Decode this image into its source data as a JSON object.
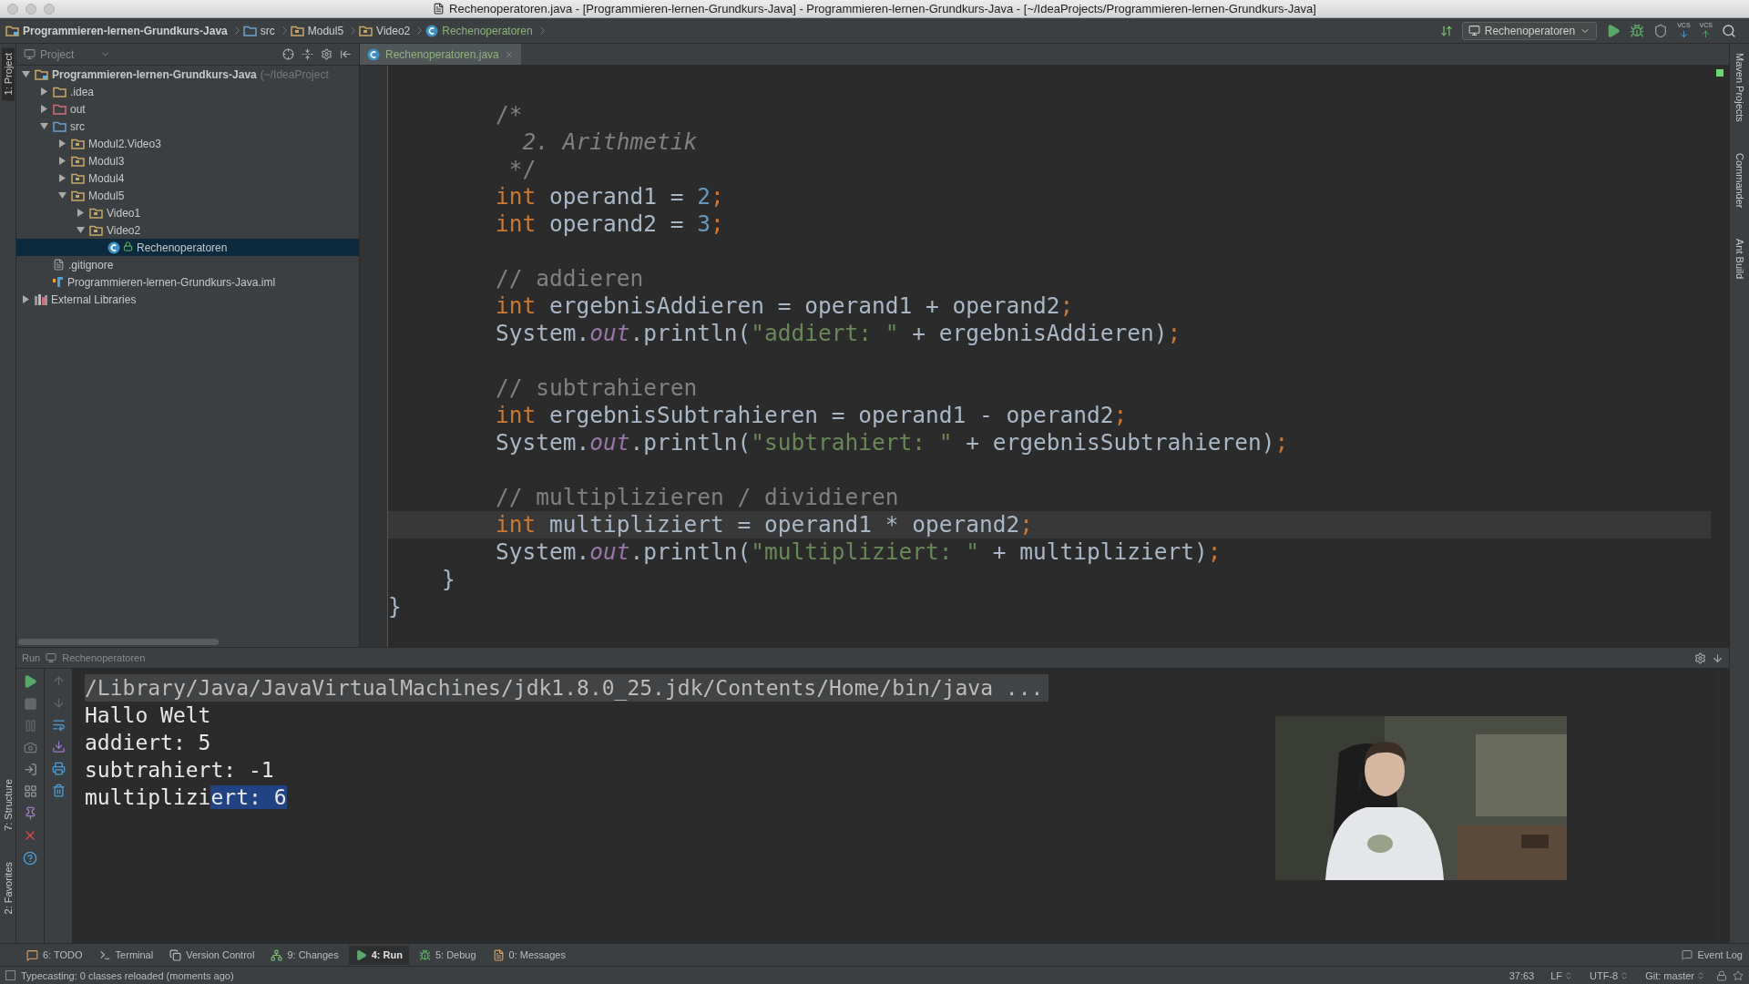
{
  "window": {
    "title": "Rechenoperatoren.java - [Programmieren-lernen-Grundkurs-Java] - Programmieren-lernen-Grundkurs-Java - [~/IdeaProjects/Programmieren-lernen-Grundkurs-Java]"
  },
  "breadcrumbs": [
    {
      "label": "Programmieren-lernen-Grundkurs-Java",
      "kind": "project"
    },
    {
      "label": "src",
      "kind": "source"
    },
    {
      "label": "Modul5",
      "kind": "package"
    },
    {
      "label": "Video2",
      "kind": "package"
    },
    {
      "label": "Rechenoperatoren",
      "kind": "class"
    }
  ],
  "toolbar": {
    "run_config": "Rechenoperatoren",
    "vcs_buttons": [
      {
        "label": "VCS",
        "kind": "update"
      },
      {
        "label": "VCS",
        "kind": "commit"
      }
    ]
  },
  "left_strip": [
    {
      "label": "1: Project",
      "selected": true
    },
    {
      "label": "7: Structure",
      "selected": false
    },
    {
      "label": "2: Favorites",
      "selected": false
    }
  ],
  "right_strip": [
    "Maven Projects",
    "Commander",
    "Ant Build"
  ],
  "project_panel": {
    "title": "Project",
    "tree": [
      {
        "label": "Programmieren-lernen-Grundkurs-Java",
        "note": "(~/IdeaProject",
        "kind": "project",
        "expanded": true,
        "selected": false,
        "children": [
          {
            "label": ".idea",
            "kind": "folder",
            "expanded": false,
            "selected": false
          },
          {
            "label": "out",
            "kind": "excluded",
            "expanded": false,
            "selected": false
          },
          {
            "label": "src",
            "kind": "source",
            "expanded": true,
            "selected": false,
            "children": [
              {
                "label": "Modul2.Video3",
                "kind": "package",
                "expanded": false,
                "selected": false
              },
              {
                "label": "Modul3",
                "kind": "package",
                "expanded": false,
                "selected": false
              },
              {
                "label": "Modul4",
                "kind": "package",
                "expanded": false,
                "selected": false
              },
              {
                "label": "Modul5",
                "kind": "package",
                "expanded": true,
                "selected": false,
                "children": [
                  {
                    "label": "Video1",
                    "kind": "package",
                    "expanded": false,
                    "selected": false
                  },
                  {
                    "label": "Video2",
                    "kind": "package",
                    "expanded": true,
                    "selected": false,
                    "children": [
                      {
                        "label": "Rechenoperatoren",
                        "kind": "class",
                        "selected": true
                      }
                    ]
                  }
                ]
              }
            ]
          },
          {
            "label": ".gitignore",
            "kind": "file",
            "selected": false
          },
          {
            "label": "Programmieren-lernen-Grundkurs-Java.iml",
            "kind": "module",
            "selected": false
          }
        ]
      },
      {
        "label": "External Libraries",
        "kind": "libraries",
        "expanded": false,
        "selected": false
      }
    ]
  },
  "editor": {
    "tab": "Rechenoperatoren.java",
    "lines": [
      {
        "current": false,
        "tokens": [
          {
            "text": "        /*",
            "kind": "comment"
          }
        ]
      },
      {
        "current": false,
        "tokens": [
          {
            "text": "          2. Arithmetik",
            "kind": "italic"
          }
        ]
      },
      {
        "current": false,
        "tokens": [
          {
            "text": "         */",
            "kind": "comment"
          }
        ]
      },
      {
        "current": false,
        "tokens": [
          {
            "text": "        int",
            "kind": "keyword"
          },
          {
            "text": " operand1 = ",
            "kind": "plain"
          },
          {
            "text": "2",
            "kind": "number"
          },
          {
            "text": ";",
            "kind": "keyword"
          }
        ]
      },
      {
        "current": false,
        "tokens": [
          {
            "text": "        int",
            "kind": "keyword"
          },
          {
            "text": " operand2 = ",
            "kind": "plain"
          },
          {
            "text": "3",
            "kind": "number"
          },
          {
            "text": ";",
            "kind": "keyword"
          }
        ]
      },
      {
        "current": false
      },
      {
        "current": false,
        "tokens": [
          {
            "text": "        // addieren",
            "kind": "comment"
          }
        ]
      },
      {
        "current": false,
        "tokens": [
          {
            "text": "        int",
            "kind": "keyword"
          },
          {
            "text": " ergebnisAddieren = operand1 + operand2",
            "kind": "plain"
          },
          {
            "text": ";",
            "kind": "keyword"
          }
        ]
      },
      {
        "current": false,
        "tokens": [
          {
            "text": "        System.",
            "kind": "plain"
          },
          {
            "text": "out",
            "kind": "field"
          },
          {
            "text": ".println(",
            "kind": "plain"
          },
          {
            "text": "\"addiert: \"",
            "kind": "string"
          },
          {
            "text": " + ergebnisAddieren)",
            "kind": "plain"
          },
          {
            "text": ";",
            "kind": "keyword"
          }
        ]
      },
      {
        "current": false
      },
      {
        "current": false,
        "tokens": [
          {
            "text": "        // subtrahieren",
            "kind": "comment"
          }
        ]
      },
      {
        "current": false,
        "tokens": [
          {
            "text": "        int",
            "kind": "keyword"
          },
          {
            "text": " ergebnisSubtrahieren = operand1 - operand2",
            "kind": "plain"
          },
          {
            "text": ";",
            "kind": "keyword"
          }
        ]
      },
      {
        "current": false,
        "tokens": [
          {
            "text": "        System.",
            "kind": "plain"
          },
          {
            "text": "out",
            "kind": "field"
          },
          {
            "text": ".println(",
            "kind": "plain"
          },
          {
            "text": "\"subtrahiert: \"",
            "kind": "string"
          },
          {
            "text": " + ergebnisSubtrahieren)",
            "kind": "plain"
          },
          {
            "text": ";",
            "kind": "keyword"
          }
        ]
      },
      {
        "current": false
      },
      {
        "current": false,
        "tokens": [
          {
            "text": "        // multiplizieren / dividieren",
            "kind": "comment"
          }
        ]
      },
      {
        "current": true,
        "tokens": [
          {
            "text": "        int",
            "kind": "keyword"
          },
          {
            "text": " multipliziert = operand1 * operand2",
            "kind": "plain"
          },
          {
            "text": ";",
            "kind": "keyword"
          }
        ]
      },
      {
        "current": false,
        "tokens": [
          {
            "text": "        System.",
            "kind": "plain"
          },
          {
            "text": "out",
            "kind": "field"
          },
          {
            "text": ".println(",
            "kind": "plain"
          },
          {
            "text": "\"multipliziert: \"",
            "kind": "string"
          },
          {
            "text": " + multipliziert)",
            "kind": "plain"
          },
          {
            "text": ";",
            "kind": "keyword"
          }
        ]
      },
      {
        "current": false,
        "tokens": [
          {
            "text": "    }",
            "kind": "plain"
          }
        ]
      },
      {
        "current": false,
        "tokens": [
          {
            "text": "}",
            "kind": "plain"
          }
        ]
      }
    ]
  },
  "run_panel": {
    "label": "Run",
    "config": "Rechenoperatoren",
    "console": [
      {
        "kind": "command",
        "segments": [
          {
            "text": "/Library/Java/JavaVirtualMachines/jdk1.8.0_25.jdk/Contents/Home/bin/java ...",
            "selected": false
          }
        ]
      },
      {
        "kind": "output",
        "segments": [
          {
            "text": "Hallo Welt",
            "selected": false
          }
        ]
      },
      {
        "kind": "output",
        "segments": [
          {
            "text": "addiert: 5",
            "selected": false
          }
        ]
      },
      {
        "kind": "output",
        "segments": [
          {
            "text": "subtrahiert: -1",
            "selected": false
          }
        ]
      },
      {
        "kind": "output",
        "segments": [
          {
            "text": "multiplizi",
            "selected": false
          },
          {
            "text": "ert: 6",
            "selected": true
          }
        ]
      }
    ]
  },
  "tool_tabs": [
    {
      "label": "6: TODO",
      "kind": "todo",
      "selected": false
    },
    {
      "label": "Terminal",
      "kind": "terminal",
      "selected": false
    },
    {
      "label": "Version Control",
      "kind": "vcs",
      "selected": false
    },
    {
      "label": "9: Changes",
      "kind": "changes",
      "selected": false
    },
    {
      "label": "4: Run",
      "kind": "run",
      "selected": true
    },
    {
      "label": "5: Debug",
      "kind": "debug",
      "selected": false
    },
    {
      "label": "0: Messages",
      "kind": "messages",
      "selected": false
    }
  ],
  "event_log": "Event Log",
  "status_bar": {
    "message": "Typecasting: 0 classes reloaded (moments ago)",
    "items": [
      {
        "label": "37:63",
        "chooser": false
      },
      {
        "label": "LF",
        "chooser": true
      },
      {
        "label": "UTF-8",
        "chooser": true
      },
      {
        "label": "Git: master",
        "chooser": true
      }
    ]
  }
}
